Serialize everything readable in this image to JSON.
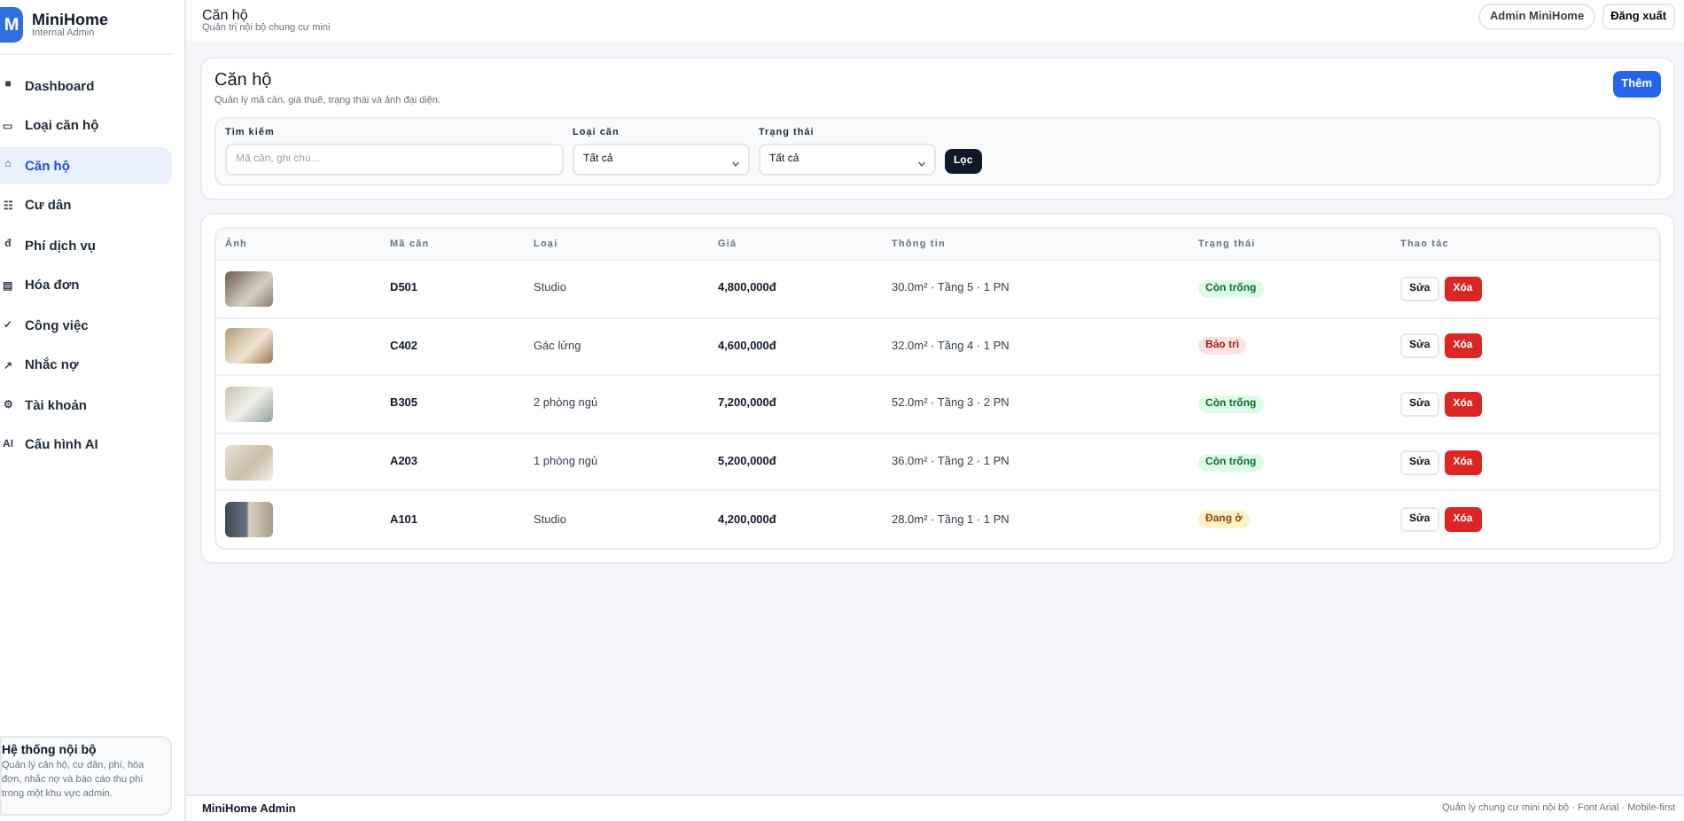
{
  "sidebar": {
    "logo": "M",
    "brand": "MiniHome",
    "subtitle": "Internal Admin",
    "items": [
      {
        "icon": "■",
        "label": "Dashboard",
        "selected": false
      },
      {
        "icon": "▭",
        "label": "Loại căn hộ",
        "selected": false
      },
      {
        "icon": "⌂",
        "label": "Căn hộ",
        "selected": true
      },
      {
        "icon": "☷",
        "label": "Cư dân",
        "selected": false
      },
      {
        "icon": "đ",
        "label": "Phí dịch vụ",
        "selected": false
      },
      {
        "icon": "▤",
        "label": "Hóa đơn",
        "selected": false
      },
      {
        "icon": "✓",
        "label": "Công việc",
        "selected": false
      },
      {
        "icon": "↗",
        "label": "Nhắc nợ",
        "selected": false
      },
      {
        "icon": "⚙",
        "label": "Tài khoản",
        "selected": false
      },
      {
        "icon": "AI",
        "label": "Cấu hình AI",
        "selected": false
      }
    ],
    "info": {
      "title": "Hệ thống nội bộ",
      "text": "Quản lý căn hộ, cư dân, phí, hóa đơn, nhắc nợ và báo cáo thu phí trong một khu vực admin."
    }
  },
  "topbar": {
    "title": "Căn hộ",
    "subtitle": "Quản trị nội bộ chung cư mini",
    "user": "Admin MiniHome",
    "logout": "Đăng xuất"
  },
  "panel": {
    "title": "Căn hộ",
    "description": "Quản lý mã căn, giá thuê, trạng thái và ảnh đại diện.",
    "add_button": "Thêm",
    "filters": {
      "search_label": "Tìm kiếm",
      "search_placeholder": "Mã căn, ghi chú...",
      "type_label": "Loại căn",
      "type_value": "Tất cả",
      "status_label": "Trạng thái",
      "status_value": "Tất cả",
      "submit": "Lọc"
    }
  },
  "table": {
    "columns": [
      "Ảnh",
      "Mã căn",
      "Loại",
      "Giá",
      "Thông tin",
      "Trạng thái",
      "Thao tác"
    ],
    "rows": [
      {
        "code": "D501",
        "type": "Studio",
        "price": "4,800,000đ",
        "info": "30.0m² · Tầng 5 · 1 PN",
        "status": "Còn trống",
        "color": "#dcfce7",
        "edit": "Sửa",
        "delete": "Xóa"
      },
      {
        "code": "C402",
        "type": "Gác lửng",
        "price": "4,600,000đ",
        "info": "32.0m² · Tầng 4 · 1 PN",
        "status": "Bảo trì",
        "color": "#fee2e2",
        "edit": "Sửa",
        "delete": "Xóa"
      },
      {
        "code": "B305",
        "type": "2 phòng ngủ",
        "price": "7,200,000đ",
        "info": "52.0m² · Tầng 3 · 2 PN",
        "status": "Còn trống",
        "color": "#dcfce7",
        "edit": "Sửa",
        "delete": "Xóa"
      },
      {
        "code": "A203",
        "type": "1 phòng ngủ",
        "price": "5,200,000đ",
        "info": "36.0m² · Tầng 2 · 1 PN",
        "status": "Còn trống",
        "color": "#dcfce7",
        "edit": "Sửa",
        "delete": "Xóa"
      },
      {
        "code": "A101",
        "type": "Studio",
        "price": "4,200,000đ",
        "info": "28.0m² · Tầng 1 · 1 PN",
        "status": "Đang ở",
        "color": "#fef3c7",
        "edit": "Sửa",
        "delete": "Xóa"
      }
    ]
  },
  "footer": {
    "left": "MiniHome Admin",
    "right": "Quản lý chung cư mini nội bộ · Font Arial · Mobile-first"
  }
}
